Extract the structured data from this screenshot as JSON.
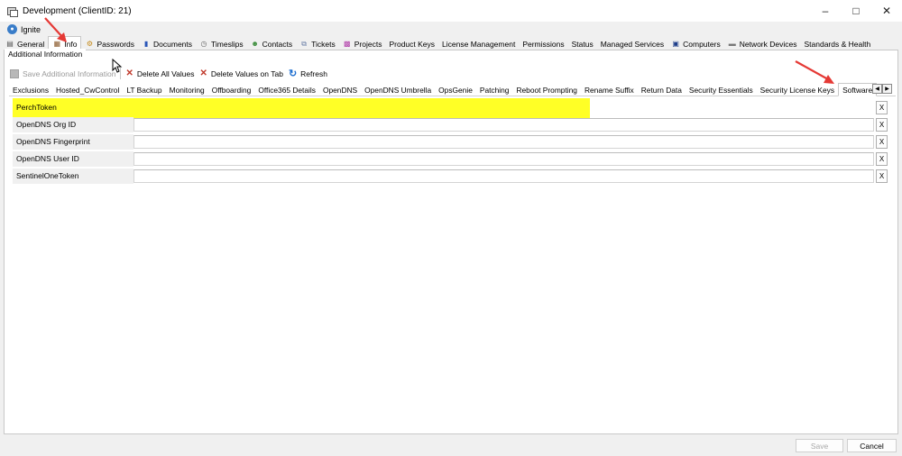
{
  "window": {
    "title": "Development   (ClientID: 21)",
    "controls": [
      "minimize-icon",
      "maximize-icon",
      "close-icon"
    ]
  },
  "nav_root": {
    "label": "Ignite"
  },
  "main_tabs": [
    {
      "label": "General",
      "icon": "general-icon"
    },
    {
      "label": "Info",
      "icon": "info-icon",
      "active": true
    },
    {
      "label": "Passwords",
      "icon": "passwords-icon"
    },
    {
      "label": "Documents",
      "icon": "documents-icon"
    },
    {
      "label": "Timeslips",
      "icon": "timeslips-icon"
    },
    {
      "label": "Contacts",
      "icon": "contacts-icon"
    },
    {
      "label": "Tickets",
      "icon": "tickets-icon"
    },
    {
      "label": "Projects",
      "icon": "projects-icon"
    },
    {
      "label": "Product Keys"
    },
    {
      "label": "License Management"
    },
    {
      "label": "Permissions"
    },
    {
      "label": "Status"
    },
    {
      "label": "Managed Services"
    },
    {
      "label": "Computers",
      "icon": "computers-icon"
    },
    {
      "label": "Network Devices",
      "icon": "network-devices-icon"
    },
    {
      "label": "Standards & Health"
    }
  ],
  "group": {
    "label": "Additional Information"
  },
  "toolbar": {
    "save_label": "Save Additional Information",
    "delete_all_label": "Delete All Values",
    "delete_tab_label": "Delete Values on Tab",
    "refresh_label": "Refresh"
  },
  "sub_tabs": [
    {
      "label": "Exclusions"
    },
    {
      "label": "Hosted_CwControl"
    },
    {
      "label": "LT Backup"
    },
    {
      "label": "Monitoring"
    },
    {
      "label": "Offboarding"
    },
    {
      "label": "Office365 Details"
    },
    {
      "label": "OpenDNS"
    },
    {
      "label": "OpenDNS Umbrella"
    },
    {
      "label": "OpsGenie"
    },
    {
      "label": "Patching"
    },
    {
      "label": "Reboot Prompting"
    },
    {
      "label": "Rename Suffix"
    },
    {
      "label": "Return Data"
    },
    {
      "label": "Security Essentials"
    },
    {
      "label": "Security License Keys"
    },
    {
      "label": "Software",
      "active": true
    }
  ],
  "fields": [
    {
      "label": "PerchToken",
      "value": "",
      "highlighted": true
    },
    {
      "label": "OpenDNS Org ID",
      "value": ""
    },
    {
      "label": "OpenDNS Fingerprint",
      "value": ""
    },
    {
      "label": "OpenDNS User ID",
      "value": ""
    },
    {
      "label": "SentinelOneToken",
      "value": ""
    }
  ],
  "clear_label": "X",
  "footer": {
    "save_label": "Save",
    "cancel_label": "Cancel"
  },
  "colors": {
    "highlight": "#ffff00",
    "annotation_arrow": "#e53935",
    "delete_icon": "#c0392b",
    "refresh_icon": "#1f6fd0"
  }
}
